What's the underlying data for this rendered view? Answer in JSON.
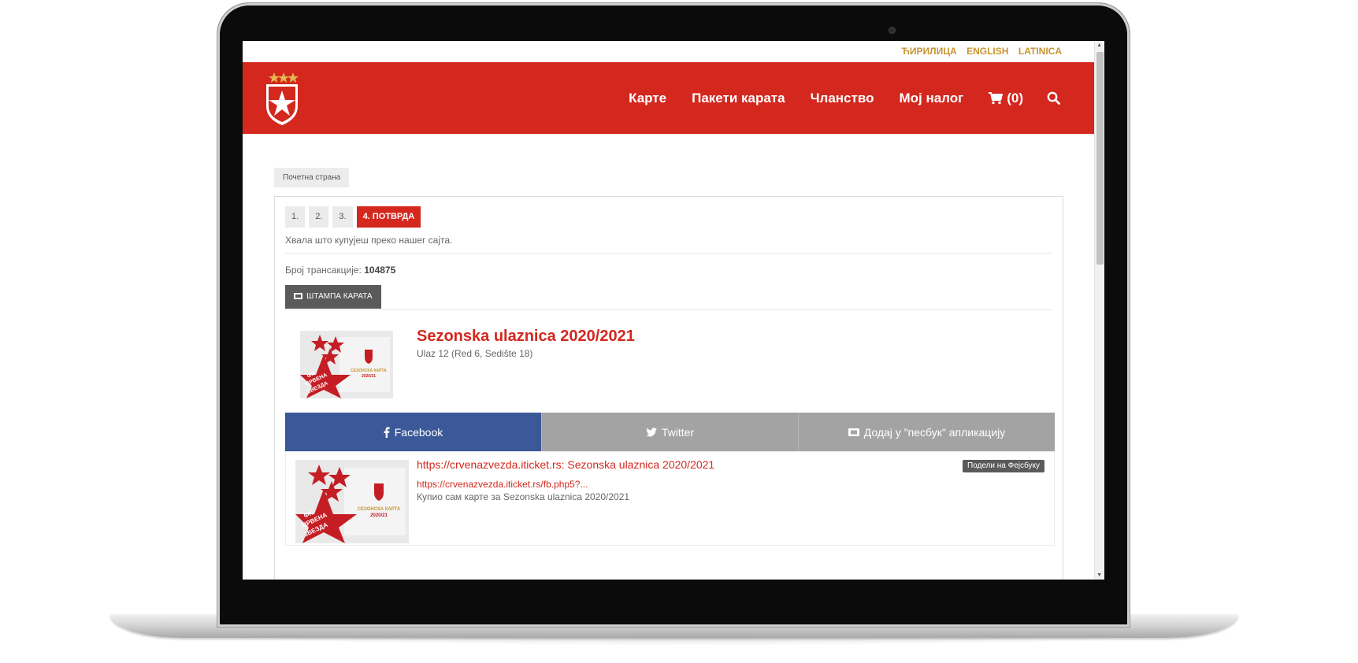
{
  "languages": [
    "ЋИРИЛИЦА",
    "ENGLISH",
    "LATINICA"
  ],
  "nav": {
    "items": [
      "Карте",
      "Пакети карата",
      "Чланство",
      "Мој налог"
    ],
    "cart_label": "(0)"
  },
  "breadcrumb": "Почетна страна",
  "steps": [
    "1.",
    "2.",
    "3.",
    "4. ПОТВРДА"
  ],
  "thanks": "Хвала што купујеш преко нашег сајта.",
  "transaction": {
    "label": "Број трансакције:",
    "number": "104875"
  },
  "print_button": "ШТАМПА КАРАТА",
  "ticket": {
    "title": "Sezonska ulaznica 2020/2021",
    "subtitle": "Ulaz 12 (Red 6, Sedište 18)",
    "image_lines": [
      "ФК",
      "ЦРВЕНА",
      "ЗВЕЗДА"
    ],
    "image_caption": "СЕЗОНСКА КАРТА",
    "image_year": "2020/21"
  },
  "share_tabs": [
    "Facebook",
    "Twitter",
    "Додај у \"песбук\" апликацију"
  ],
  "share": {
    "link_title": "https://crvenazvezda.iticket.rs: Sezonska ulaznica 2020/2021",
    "url": "https://crvenazvezda.iticket.rs/fb.php5?...",
    "text": "Купио сам карте за Sezonska ulaznica 2020/2021",
    "button": "Подели на Фејсбуку"
  },
  "colors": {
    "brand_red": "#d4271e",
    "gold": "#c89430",
    "facebook_blue": "#3b5998",
    "gray_tab": "#a3a3a3"
  }
}
